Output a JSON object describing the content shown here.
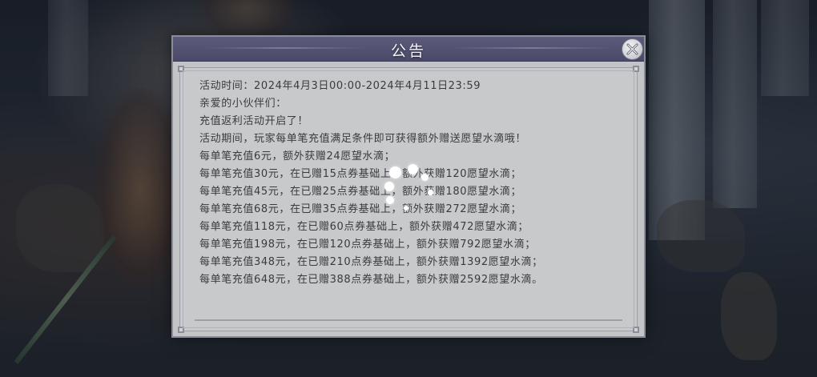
{
  "dialog": {
    "title": "公告",
    "close_icon": "close-x-icon"
  },
  "announcement": {
    "lines": [
      "活动时间：2024年4月3日00:00-2024年4月11日23:59",
      "亲爱的小伙伴们：",
      "充值返利活动开启了！",
      "活动期间，玩家每单笔充值满足条件即可获得额外赠送愿望水滴哦！",
      "每单笔充值6元，额外获赠24愿望水滴；",
      "每单笔充值30元，在已赠15点券基础上，额外获赠120愿望水滴；",
      "每单笔充值45元，在已赠25点券基础上，额外获赠180愿望水滴；",
      "每单笔充值68元，在已赠35点券基础上，额外获赠272愿望水滴；",
      "每单笔充值118元，在已赠60点券基础上，额外获赠472愿望水滴；",
      "每单笔充值198元，在已赠120点券基础上，额外获赠792愿望水滴；",
      "每单笔充值348元，在已赠210点券基础上，额外获赠1392愿望水滴；",
      "每单笔充值648元，在已赠388点券基础上，额外获赠2592愿望水滴。"
    ]
  },
  "loading": {
    "icon": "loading-spinner-icon"
  },
  "colors": {
    "header": "#4f4e6e",
    "panel": "#c3c4c6",
    "text": "#3a3b3f",
    "title_text": "#f4f2f8"
  }
}
